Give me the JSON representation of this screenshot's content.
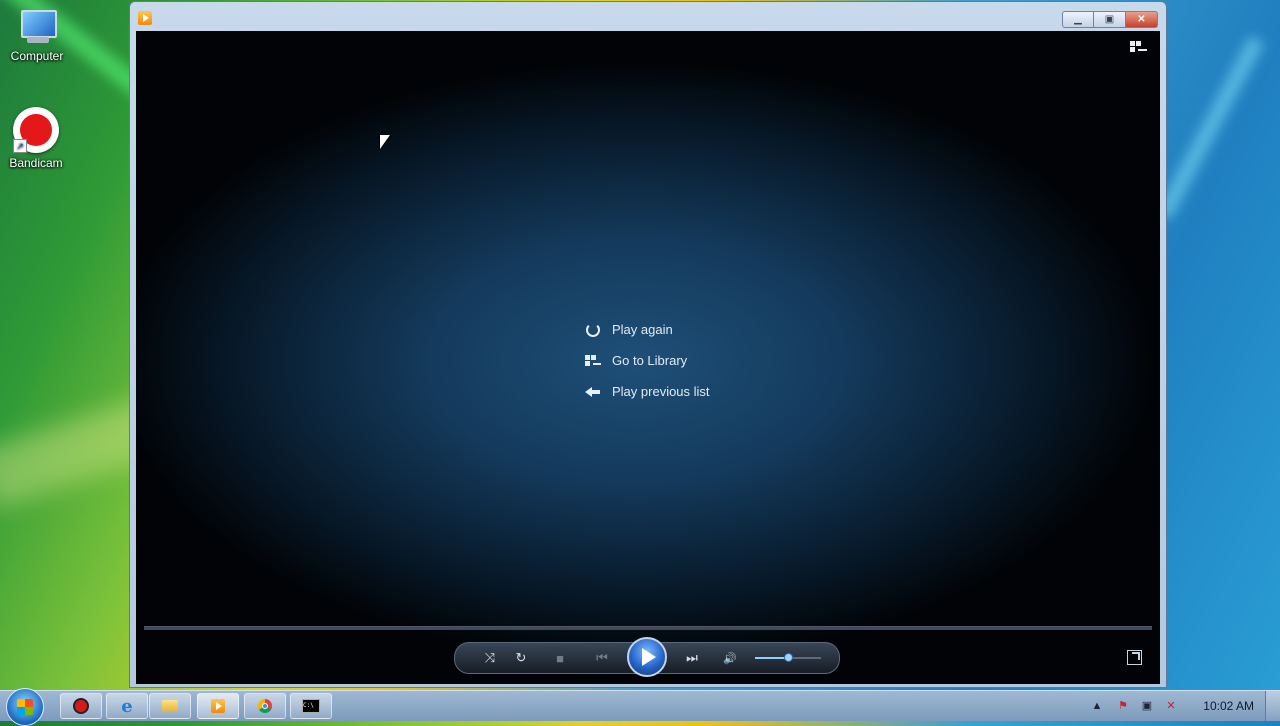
{
  "desktop": {
    "icons": [
      {
        "label": "Computer",
        "icon": "computer-icon"
      },
      {
        "label": "Bandicam",
        "icon": "bandicam-icon"
      }
    ]
  },
  "player": {
    "app": "Windows Media Player",
    "menu": [
      {
        "label": "Play again",
        "icon": "replay-icon"
      },
      {
        "label": "Go to Library",
        "icon": "library-icon"
      },
      {
        "label": "Play previous list",
        "icon": "back-arrow-icon"
      }
    ],
    "controls": {
      "shuffle": "⤨",
      "repeat": "↻",
      "stop": "■",
      "previous": "⏮",
      "next": "⏭",
      "mute": "🔊",
      "volume_fraction": 0.5
    },
    "colors": {
      "accent": "#2466c9",
      "background": "#143a5c"
    }
  },
  "taskbar": {
    "buttons": [
      "Bandicam",
      "Internet Explorer",
      "Windows Explorer",
      "Windows Media Player",
      "Google Chrome",
      "Command Prompt"
    ],
    "clock": "10:02 AM"
  }
}
